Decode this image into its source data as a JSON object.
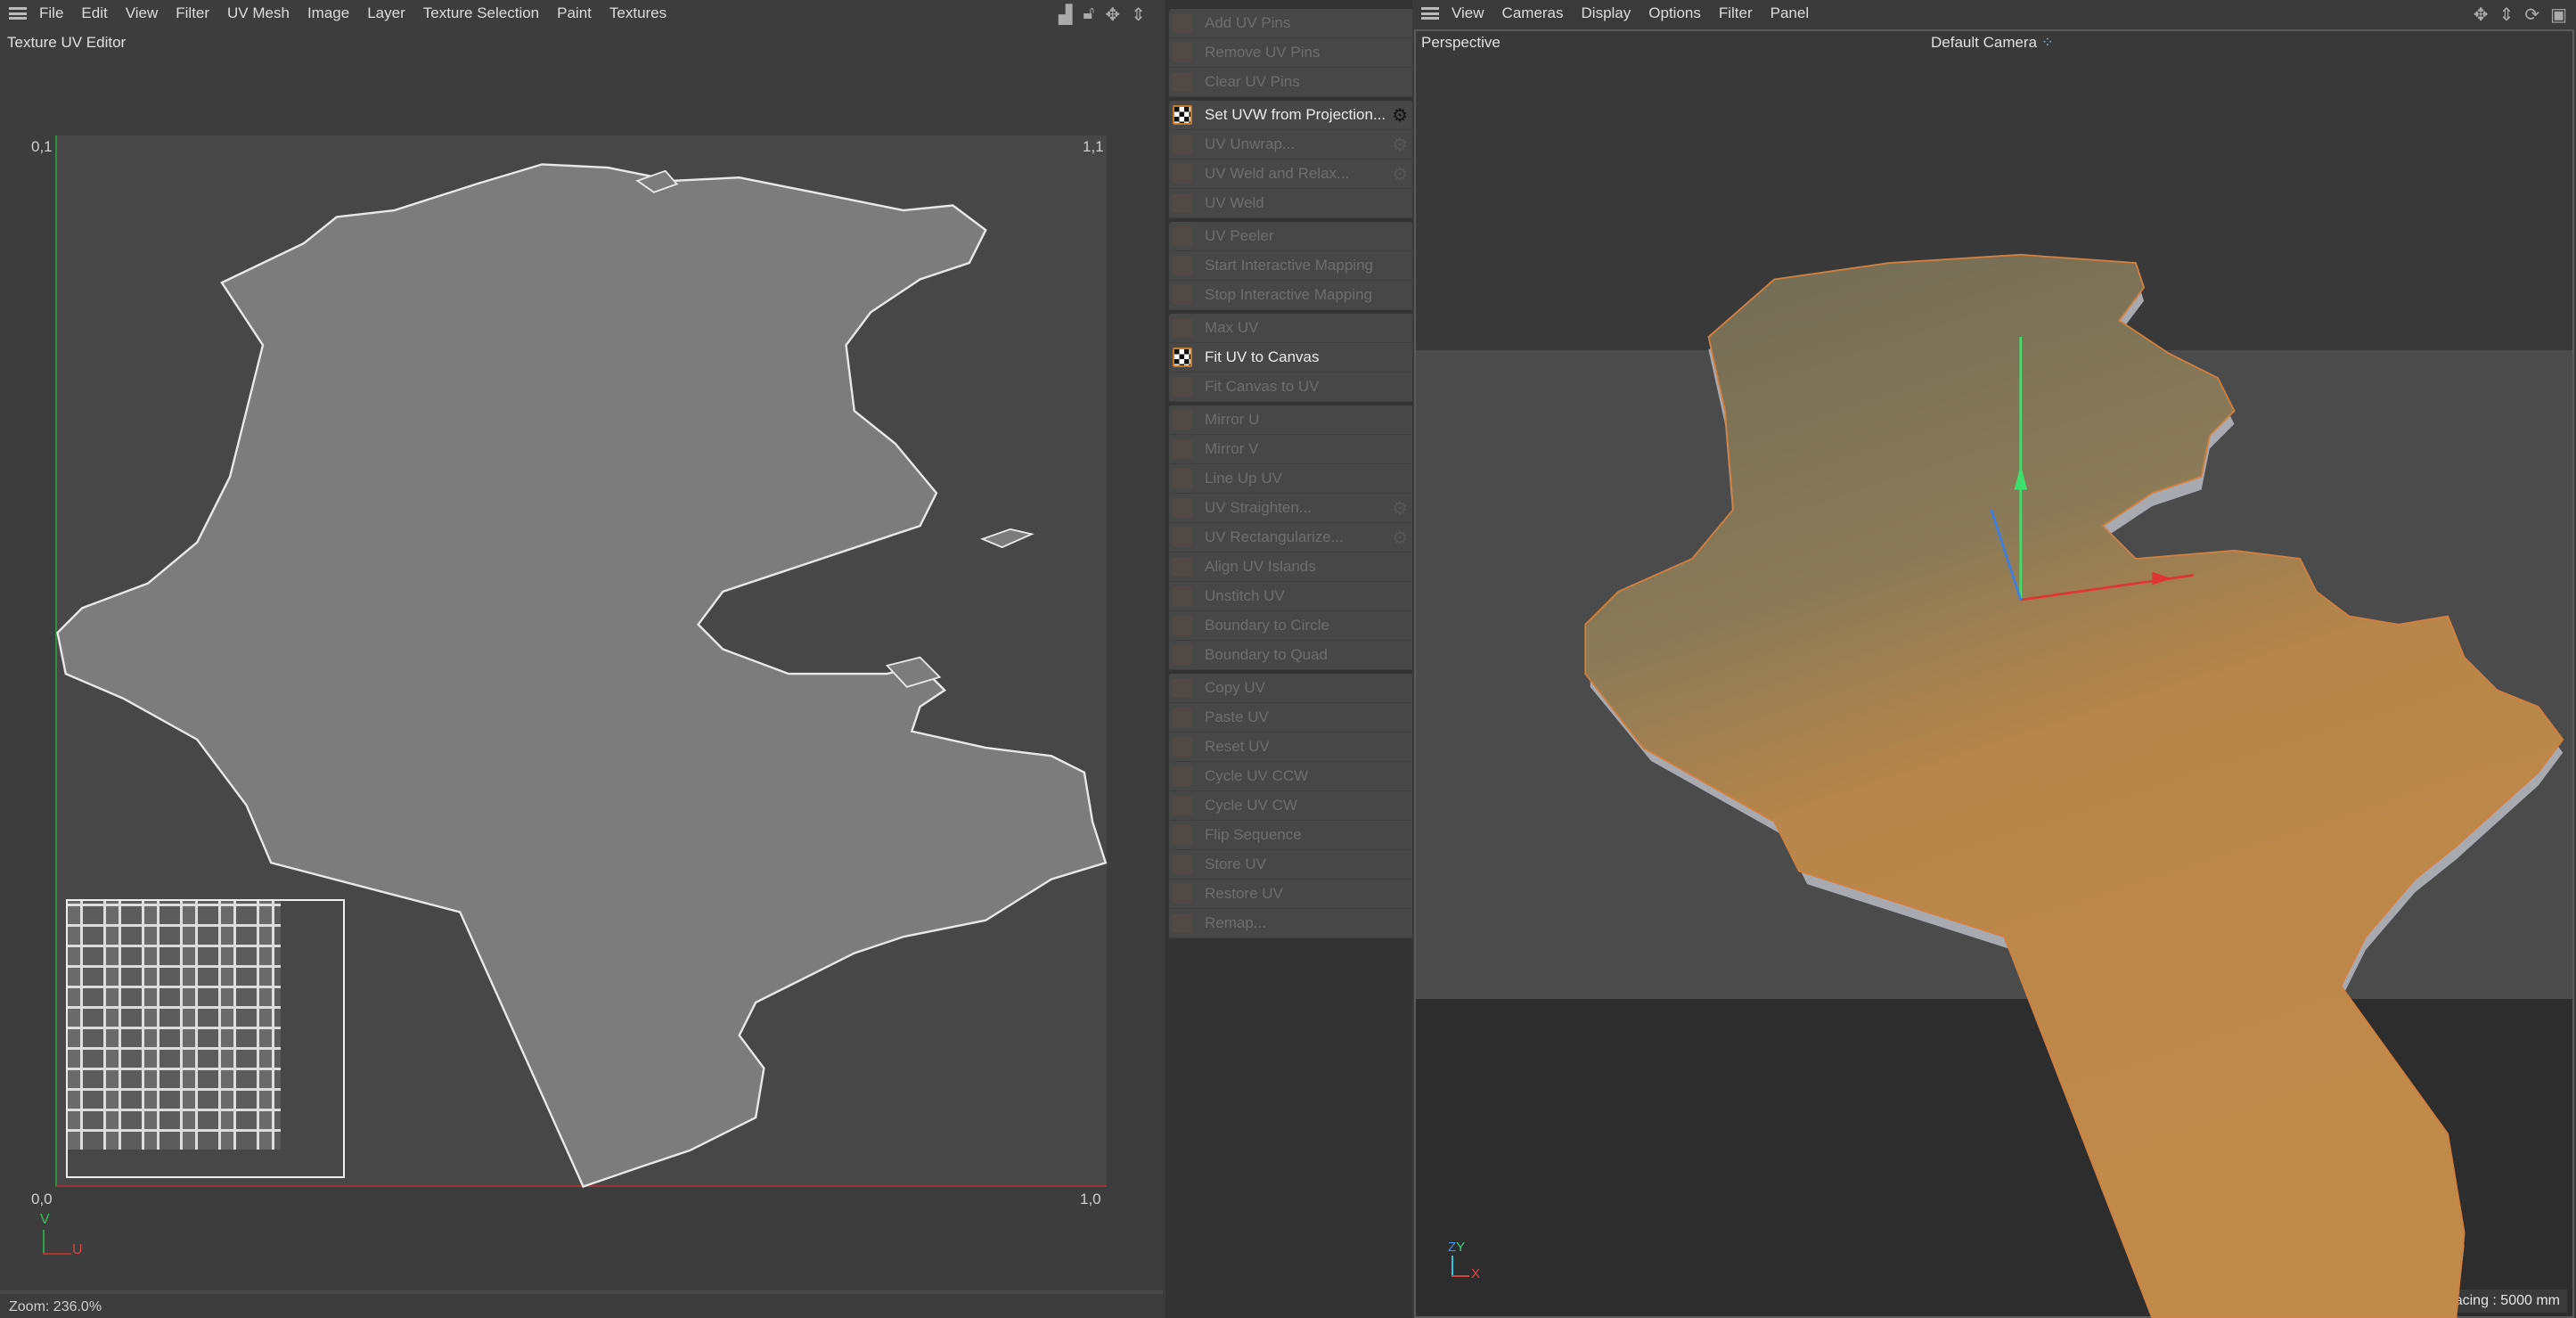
{
  "uv_editor": {
    "menu": [
      "File",
      "Edit",
      "View",
      "Filter",
      "UV Mesh",
      "Image",
      "Layer",
      "Texture Selection",
      "Paint",
      "Textures"
    ],
    "title": "Texture UV Editor",
    "corners": {
      "top_left": "0,1",
      "top_right": "1,1",
      "bottom_left": "0,0",
      "bottom_right": "1,0"
    },
    "axis_v": "V",
    "axis_u": "U",
    "status": "Zoom: 236.0%",
    "colors": {
      "v_axis": "#2f8f3f",
      "u_axis": "#a03535",
      "uv_island": "#7c7c7c"
    }
  },
  "toolbar": {
    "groups": [
      [
        {
          "label": "Add UV Pins",
          "enabled": false
        },
        {
          "label": "Remove UV Pins",
          "enabled": false
        },
        {
          "label": "Clear UV Pins",
          "enabled": false
        }
      ],
      [
        {
          "label": "Set UVW from Projection...",
          "enabled": true,
          "gear": true
        },
        {
          "label": "UV Unwrap...",
          "enabled": false,
          "gear": true
        },
        {
          "label": "UV Weld and Relax...",
          "enabled": false,
          "gear": true
        },
        {
          "label": "UV Weld",
          "enabled": false
        }
      ],
      [
        {
          "label": "UV Peeler",
          "enabled": false
        },
        {
          "label": "Start Interactive Mapping",
          "enabled": false
        },
        {
          "label": "Stop Interactive Mapping",
          "enabled": false
        }
      ],
      [
        {
          "label": "Max UV",
          "enabled": false
        },
        {
          "label": "Fit UV to Canvas",
          "enabled": true
        },
        {
          "label": "Fit Canvas to UV",
          "enabled": false
        }
      ],
      [
        {
          "label": "Mirror U",
          "enabled": false
        },
        {
          "label": "Mirror V",
          "enabled": false
        },
        {
          "label": "Line Up UV",
          "enabled": false
        },
        {
          "label": "UV Straighten...",
          "enabled": false,
          "gear": true
        },
        {
          "label": "UV Rectangularize...",
          "enabled": false,
          "gear": true
        },
        {
          "label": "Align UV Islands",
          "enabled": false
        },
        {
          "label": "Unstitch UV",
          "enabled": false
        },
        {
          "label": "Boundary to Circle",
          "enabled": false
        },
        {
          "label": "Boundary to Quad",
          "enabled": false
        }
      ],
      [
        {
          "label": "Copy UV",
          "enabled": false
        },
        {
          "label": "Paste UV",
          "enabled": false
        },
        {
          "label": "Reset UV",
          "enabled": false
        },
        {
          "label": "Cycle UV CCW",
          "enabled": false
        },
        {
          "label": "Cycle UV CW",
          "enabled": false
        },
        {
          "label": "Flip Sequence",
          "enabled": false
        },
        {
          "label": "Store UV",
          "enabled": false
        },
        {
          "label": "Restore UV",
          "enabled": false
        },
        {
          "label": "Remap...",
          "enabled": false
        }
      ]
    ]
  },
  "viewport": {
    "menu": [
      "View",
      "Cameras",
      "Display",
      "Options",
      "Filter",
      "Panel"
    ],
    "view_name": "Perspective",
    "camera": "Default Camera",
    "grid_spacing": "Grid Spacing : 5000 mm",
    "axes": {
      "z": "Z",
      "y": "Y",
      "x": "X"
    }
  }
}
